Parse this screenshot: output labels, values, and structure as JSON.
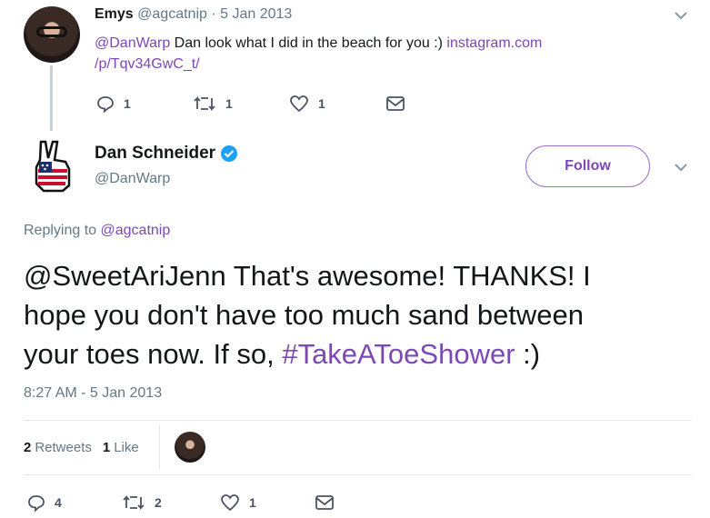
{
  "reply_tweet": {
    "name": "Emys",
    "handle": "@agcatnip",
    "separator": "·",
    "date": "5 Jan 2013",
    "mention": "@DanWarp",
    "text": " Dan look what I did in the beach  for you :) ",
    "link_part1": "instagram.com",
    "link_part2": "/p/Tqv34GwC_t/",
    "replies": "1",
    "retweets": "1",
    "likes": "1"
  },
  "main_tweet": {
    "name": "Dan Schneider",
    "handle": "@DanWarp",
    "follow_label": "Follow",
    "replying_prefix": "Replying to ",
    "replying_handle": "@agcatnip",
    "text_line1": "@SweetAriJenn That's awesome!  THANKS!  I",
    "text_line2": "hope you don't have too much sand between",
    "text_line3_prefix": "your toes now.  If so, ",
    "hashtag": "#TakeAToeShower",
    "text_line3_suffix": " :)",
    "timestamp": "8:27 AM - 5 Jan 2013",
    "retweets_count": "2",
    "retweets_label": "Retweets",
    "likes_count": "1",
    "likes_label": "Like",
    "replies": "4",
    "retweets": "2",
    "likes": "1"
  },
  "icons": [
    "caret-down-icon",
    "reply-icon",
    "retweet-icon",
    "heart-icon",
    "envelope-icon",
    "verified-badge-icon"
  ],
  "colors": {
    "accent": "#7b48b5",
    "muted": "#657786",
    "text": "#14171a"
  }
}
